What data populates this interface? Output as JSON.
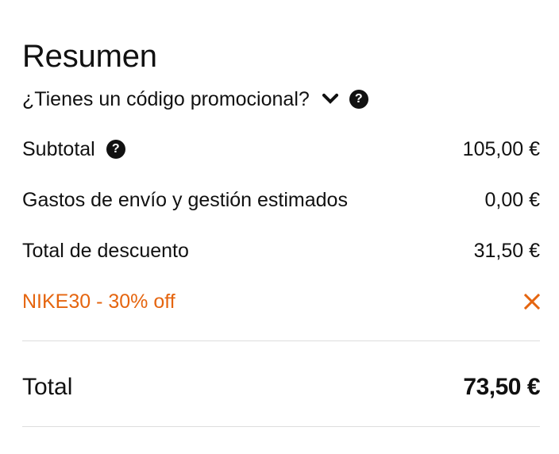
{
  "summary": {
    "title": "Resumen",
    "promo_prompt": "¿Tienes un código promocional?",
    "subtotal": {
      "label": "Subtotal",
      "value": "105,00 €"
    },
    "shipping": {
      "label": "Gastos de envío y gestión estimados",
      "value": "0,00 €"
    },
    "discount": {
      "label": "Total de descuento",
      "value": "31,50 €"
    },
    "applied_promo": {
      "label": "NIKE30 - 30% off",
      "remove_icon": "close-icon",
      "color": "#e5650f"
    },
    "total": {
      "label": "Total",
      "value": "73,50 €"
    },
    "icons": {
      "help": "help-icon",
      "chevron": "chevron-down-icon"
    }
  }
}
